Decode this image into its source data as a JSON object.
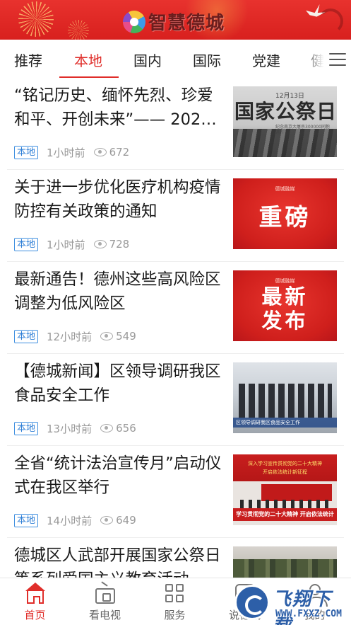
{
  "header": {
    "app_name": "智慧德城",
    "logo_icon": "colorful-ring-logo-icon"
  },
  "tabs": [
    {
      "label": "推荐",
      "active": false
    },
    {
      "label": "本地",
      "active": true
    },
    {
      "label": "国内",
      "active": false
    },
    {
      "label": "国际",
      "active": false
    },
    {
      "label": "党建",
      "active": false
    },
    {
      "label": "健",
      "active": false
    }
  ],
  "tabs_menu_icon": "hamburger-menu-icon",
  "news": [
    {
      "title": "“铭记历史、缅怀先烈、珍爱和平、开创未来”—— 2022…",
      "tag": "本地",
      "time": "1小时前",
      "views": "672",
      "thumb": {
        "big": "国家公祭日",
        "date": "12月13日",
        "sub": "纪念南京大屠杀300000同胞遇难"
      }
    },
    {
      "title": "关于进一步优化医疗机构疫情防控有关政策的通知",
      "tag": "本地",
      "time": "1小时前",
      "views": "728",
      "thumb": {
        "brand": "德城融媒",
        "big": "重磅"
      }
    },
    {
      "title": "最新通告！德州这些高风险区调整为低风险区",
      "tag": "本地",
      "time": "12小时前",
      "views": "549",
      "thumb": {
        "brand": "德城融媒",
        "line1": "最新",
        "line2": "发布"
      }
    },
    {
      "title": "【德城新闻】区领导调研我区食品安全工作",
      "tag": "本地",
      "time": "13小时前",
      "views": "656",
      "thumb": {
        "caption": "区领导调研我区食品安全工作"
      }
    },
    {
      "title": "全省“统计法治宣传月”启动仪式在我区举行",
      "tag": "本地",
      "time": "14小时前",
      "views": "649",
      "thumb": {
        "line1": "深入学习宣传贯彻党的二十大精神",
        "line2": "开启依法统计新征程",
        "banner": "学习贯彻党的二十大精神  开启依法统计"
      }
    },
    {
      "title": "德城区人武部开展国家公祭日等系列爱国主义教育活动",
      "tag": "",
      "time": "",
      "views": "",
      "thumb": {}
    }
  ],
  "bottom_nav": [
    {
      "label": "首页",
      "icon": "home-icon",
      "active": true
    },
    {
      "label": "看电视",
      "icon": "tv-icon",
      "active": false
    },
    {
      "label": "服务",
      "icon": "grid-icon",
      "active": false
    },
    {
      "label": "说德城",
      "icon": "chat-icon",
      "active": false
    },
    {
      "label": "我的",
      "icon": "user-icon",
      "active": false
    }
  ],
  "watermark": {
    "title": "飞翔下载",
    "url": "WWW.FXXZ.COM"
  },
  "colors": {
    "brand_red": "#e02e2a",
    "tag_blue": "#2f7fd6",
    "header_red": "#d8201e"
  }
}
